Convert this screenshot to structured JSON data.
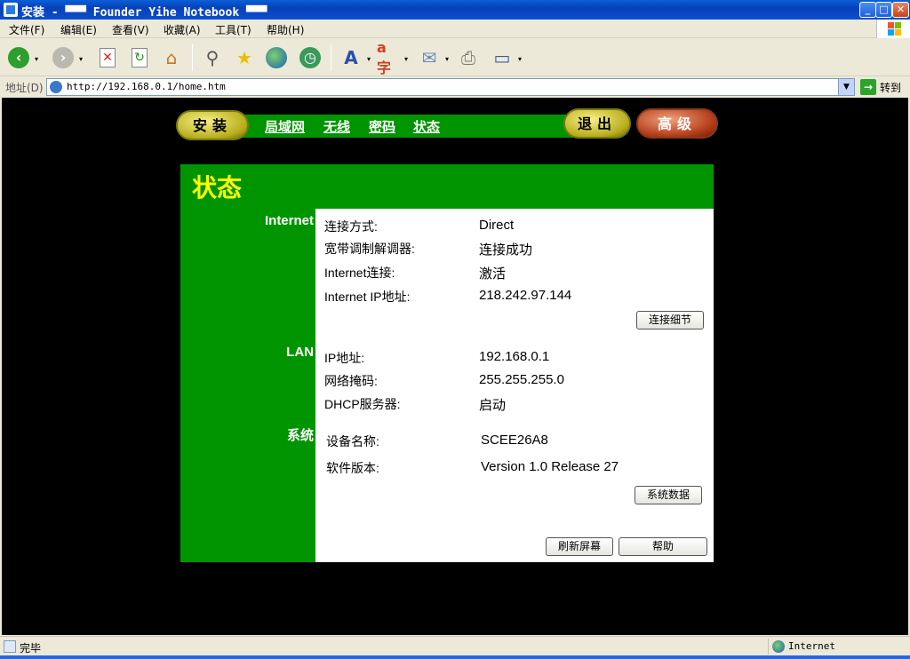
{
  "window": {
    "title": "安装 - ▀▀▀ Founder Yihe Notebook ▀▀▀",
    "minimize": "_",
    "maximize": "□",
    "close": "✕"
  },
  "menu": {
    "items": [
      "文件(F)",
      "编辑(E)",
      "查看(V)",
      "收藏(A)",
      "工具(T)",
      "帮助(H)"
    ]
  },
  "toolbar": {
    "icons": [
      "back-icon",
      "forward-icon",
      "stop-icon",
      "refresh-icon",
      "home-icon",
      "search-icon",
      "favorites-icon",
      "media-icon",
      "history-icon",
      "font-icon",
      "encoding-icon",
      "mail-icon",
      "print-icon",
      "edit-icon"
    ]
  },
  "address": {
    "label": "地址(D)",
    "url": "http://192.168.0.1/home.htm",
    "go_label": "转到"
  },
  "nav": {
    "install": "安装",
    "links": [
      "局域网",
      "无线",
      "密码",
      "状态"
    ],
    "logout": "退出",
    "advanced": "高级"
  },
  "page": {
    "title": "状态",
    "sections": {
      "internet": {
        "heading": "Internet",
        "rows": [
          {
            "label": "连接方式:",
            "value": "Direct"
          },
          {
            "label": "宽带调制解调器:",
            "value": "连接成功"
          },
          {
            "label": "Internet连接:",
            "value": "激活"
          },
          {
            "label": "Internet IP地址:",
            "value": "218.242.97.144"
          }
        ],
        "button": "连接细节"
      },
      "lan": {
        "heading": "LAN",
        "rows": [
          {
            "label": "IP地址:",
            "value": "192.168.0.1"
          },
          {
            "label": "网络掩码:",
            "value": "255.255.255.0"
          },
          {
            "label": "DHCP服务器:",
            "value": "启动"
          }
        ]
      },
      "system": {
        "heading": "系统",
        "rows": [
          {
            "label": "设备名称:",
            "value": "SCEE26A8"
          },
          {
            "label": "软件版本:",
            "value": "Version 1.0 Release 27"
          }
        ],
        "button": "系统数据"
      }
    },
    "refresh_button": "刷新屏幕",
    "help_button": "帮助"
  },
  "status": {
    "text": "完毕",
    "zone": "Internet"
  },
  "colors": {
    "panel_green": "#009500",
    "title_yellow": "#ffff00",
    "content_bg": "#000000"
  }
}
